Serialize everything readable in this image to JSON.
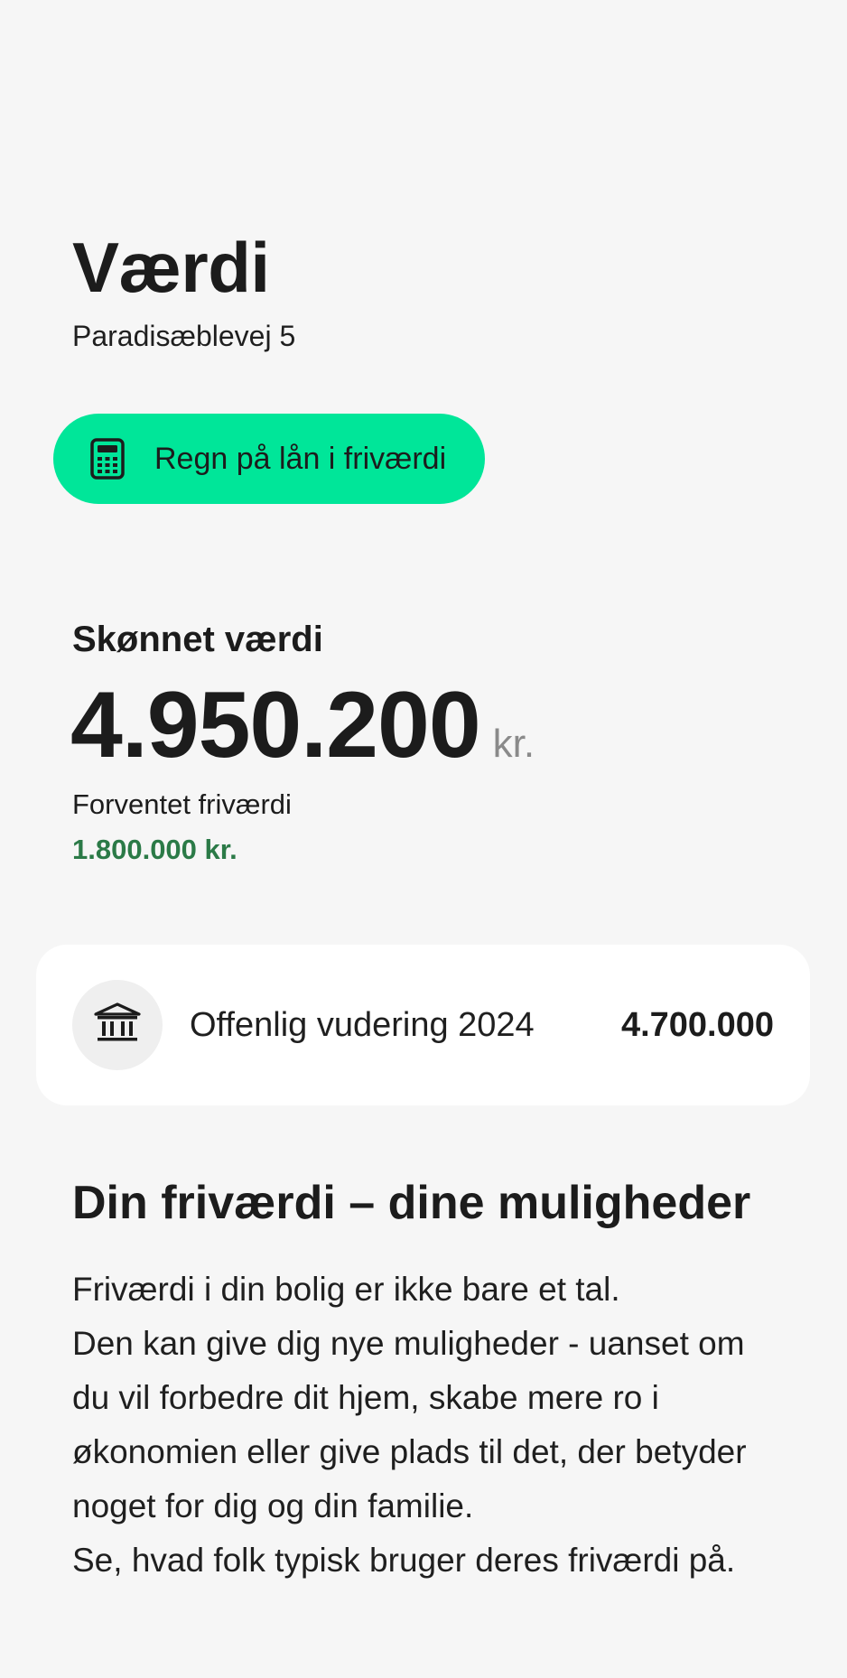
{
  "header": {
    "title": "Værdi",
    "address": "Paradisæblevej 5"
  },
  "cta": {
    "icon": "calculator-icon",
    "label": "Regn på lån i friværdi",
    "background": "#00e699"
  },
  "estimate": {
    "label": "Skønnet værdi",
    "value": "4.950.200",
    "unit": "kr."
  },
  "equity": {
    "label": "Forventet friværdi",
    "value": "1.800.000 kr.",
    "color": "#2b7a47"
  },
  "assessment_card": {
    "icon": "bank-icon",
    "label": "Offenlig vudering 2024",
    "value": "4.700.000"
  },
  "section": {
    "title": "Din friværdi – dine muligheder",
    "paragraphs": [
      "Friværdi i din bolig er ikke bare et tal.",
      "Den kan give dig nye muligheder - uanset om du vil forbedre dit hjem, skabe mere ro i økonomien eller give plads til det, der betyder noget for dig og din familie.",
      "Se, hvad folk typisk bruger deres friværdi på."
    ]
  }
}
